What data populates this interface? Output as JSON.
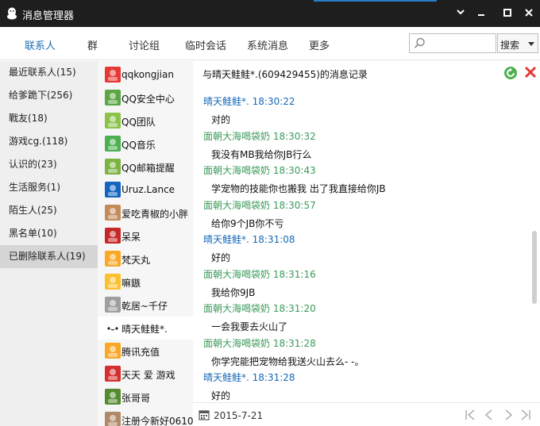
{
  "window": {
    "title": "消息管理器"
  },
  "tabs": [
    {
      "label": "联系人"
    },
    {
      "label": "群"
    },
    {
      "label": "讨论组"
    },
    {
      "label": "临时会话"
    },
    {
      "label": "系统消息"
    },
    {
      "label": "更多"
    }
  ],
  "search": {
    "value": "",
    "button_label": "搜索"
  },
  "categories": [
    {
      "label": "最近联系人(15)"
    },
    {
      "label": "给爹跪下(256)"
    },
    {
      "label": "戰友(18)"
    },
    {
      "label": "游戏cg.(118)"
    },
    {
      "label": "认识的(23)"
    },
    {
      "label": "生活服务(1)"
    },
    {
      "label": "陌生人(25)"
    },
    {
      "label": "黑名单(10)"
    },
    {
      "label": "已删除联系人(19)"
    }
  ],
  "contacts": [
    {
      "name": "qqkongjian",
      "avatar_color": "#e53935"
    },
    {
      "name": "QQ安全中心",
      "avatar_color": "#5ca646"
    },
    {
      "name": "QQ团队",
      "avatar_color": "#8bc34a"
    },
    {
      "name": "QQ音乐",
      "avatar_color": "#4caf50"
    },
    {
      "name": "QQ邮箱提醒",
      "avatar_color": "#7cb342"
    },
    {
      "name": "Uruz.Lance",
      "avatar_color": "#1565c0"
    },
    {
      "name": "爱吃青椒的小胖",
      "avatar_color": "#c48a5a"
    },
    {
      "name": "呆呆",
      "avatar_color": "#c62828"
    },
    {
      "name": "梵天丸",
      "avatar_color": "#f9a825"
    },
    {
      "name": "嘛鏃",
      "avatar_color": "#fbc02d"
    },
    {
      "name": "乾居~千仔",
      "avatar_color": "#9e9e9e"
    },
    {
      "name": "晴天鲑鲑*.",
      "avatar_color": "#ffffff"
    },
    {
      "name": "腾讯充值",
      "avatar_color": "#f9a825"
    },
    {
      "name": "天天 爱 游戏",
      "avatar_color": "#d32f2f"
    },
    {
      "name": "张哥哥",
      "avatar_color": "#558b2f"
    },
    {
      "name": "注册今新好0610",
      "avatar_color": "#b08968"
    }
  ],
  "conversation": {
    "title": "与晴天鲑鲑*.(609429455)的消息记录",
    "messages": [
      {
        "sender": "晴天鲑鲑*. 18:30:22",
        "text": "对的",
        "sender_color": "blue"
      },
      {
        "sender": "面朝大海喝袋奶 18:30:32",
        "text": "我没有MB我给你JB行么",
        "sender_color": "green"
      },
      {
        "sender": "面朝大海喝袋奶 18:30:43",
        "text": "学宠物的技能你也搬我 出了我直接给你JB",
        "sender_color": "green"
      },
      {
        "sender": "面朝大海喝袋奶 18:30:57",
        "text": "给你9个JB你不亏",
        "sender_color": "green"
      },
      {
        "sender": "晴天鲑鲑*. 18:31:08",
        "text": "好的",
        "sender_color": "blue"
      },
      {
        "sender": "面朝大海喝袋奶 18:31:16",
        "text": "我给你9JB",
        "sender_color": "green"
      },
      {
        "sender": "面朝大海喝袋奶 18:31:20",
        "text": "一会我要去火山了",
        "sender_color": "green"
      },
      {
        "sender": "面朝大海喝袋奶 18:31:28",
        "text": "你学完能把宠物给我送火山去么- -。",
        "sender_color": "green"
      },
      {
        "sender": "晴天鲑鲑*. 18:31:28",
        "text": "好的",
        "sender_color": "blue"
      }
    ]
  },
  "bottom": {
    "date": "2015-7-21"
  },
  "colors": {
    "accent_blue": "#1769b8",
    "sender_green": "#3b9a5a",
    "title_bar": "#1e1e1e"
  }
}
